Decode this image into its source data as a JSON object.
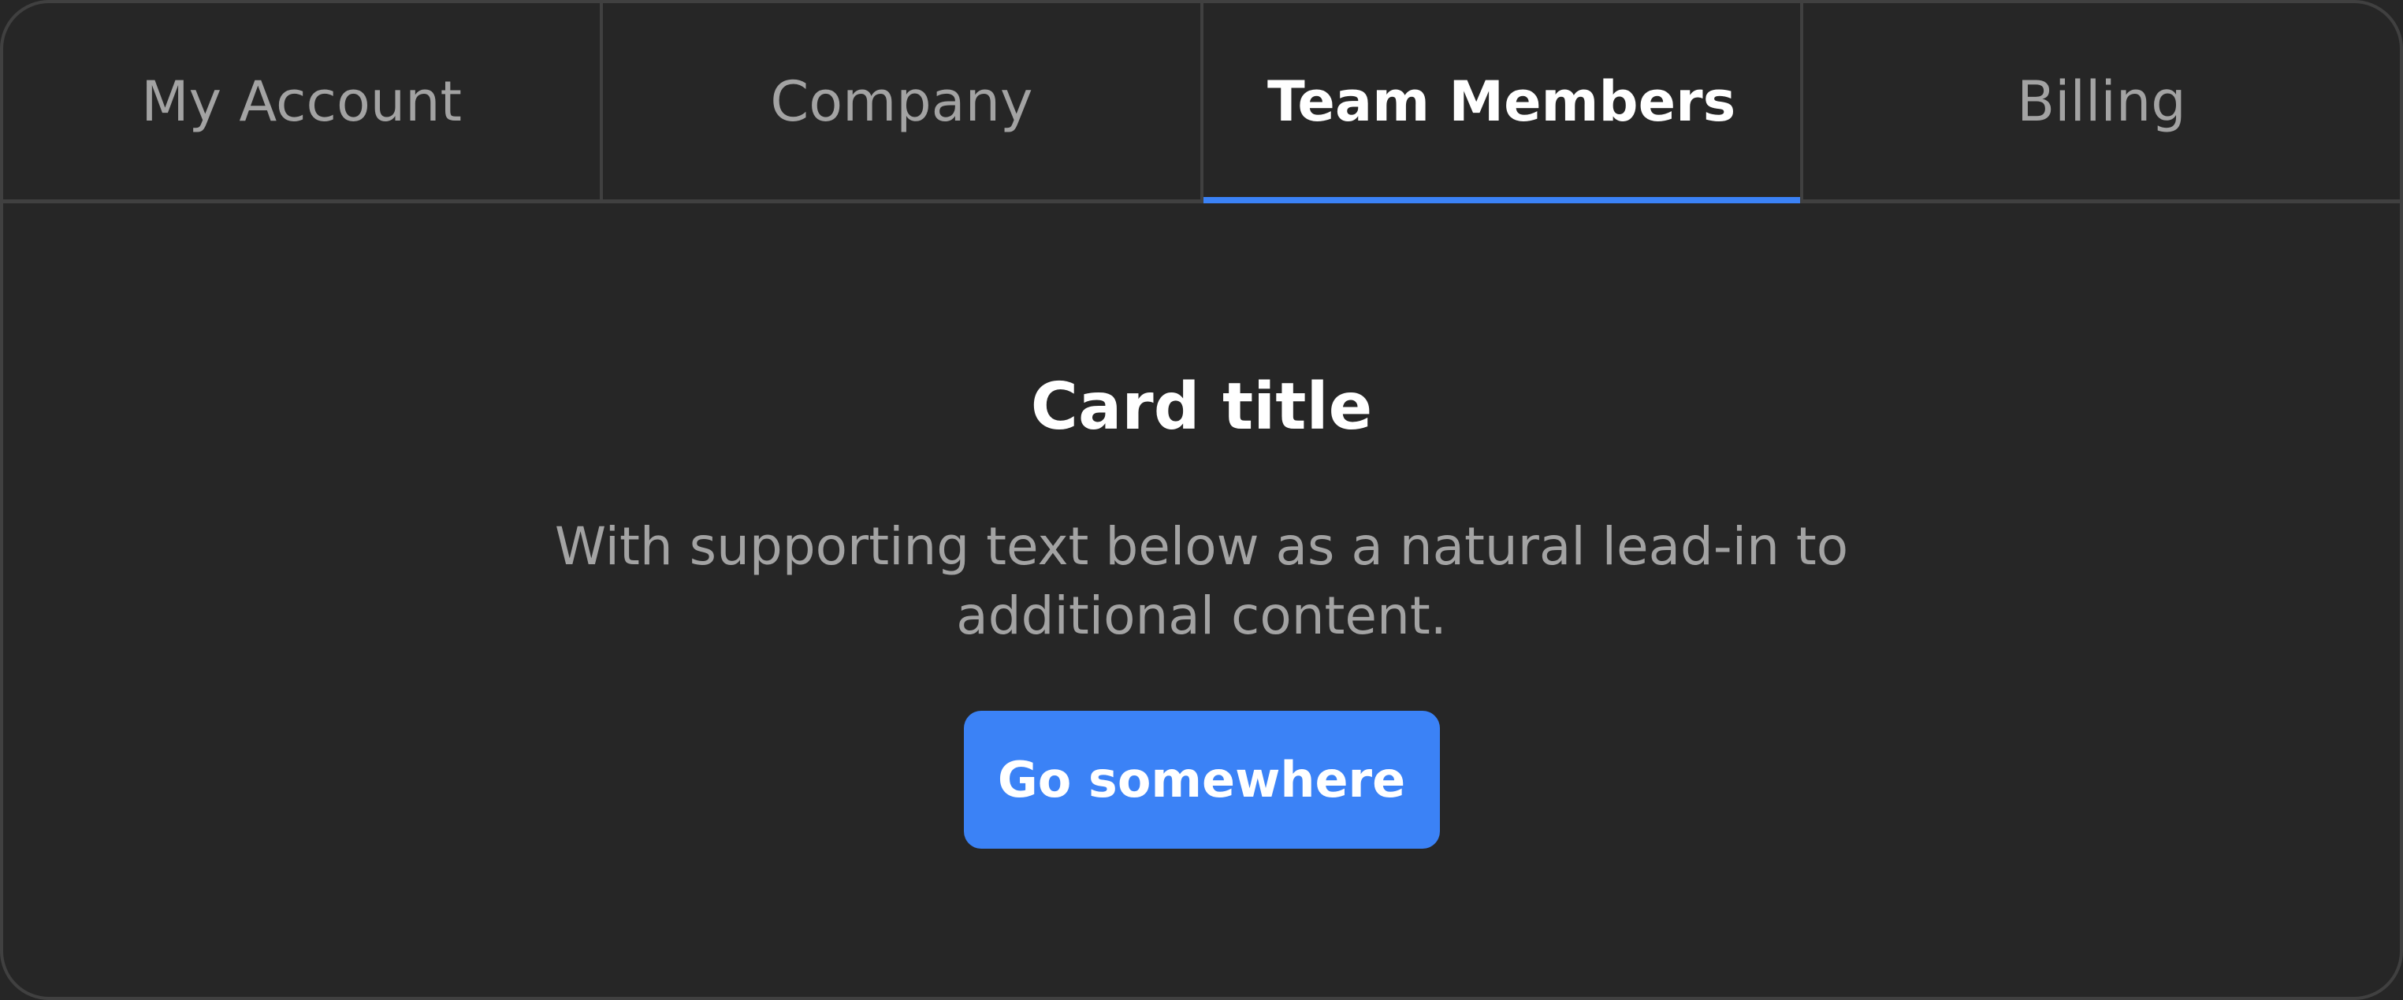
{
  "tabs": [
    {
      "label": "My Account",
      "active": false
    },
    {
      "label": "Company",
      "active": false
    },
    {
      "label": "Team Members",
      "active": true
    },
    {
      "label": "Billing",
      "active": false
    }
  ],
  "card": {
    "title": "Card title",
    "text": "With supporting text below as a natural lead-in to additional content.",
    "button_label": "Go somewhere"
  },
  "colors": {
    "background": "#262626",
    "border": "#404040",
    "accent": "#3b82f6",
    "muted_text": "#a3a3a3",
    "text": "#ffffff"
  }
}
